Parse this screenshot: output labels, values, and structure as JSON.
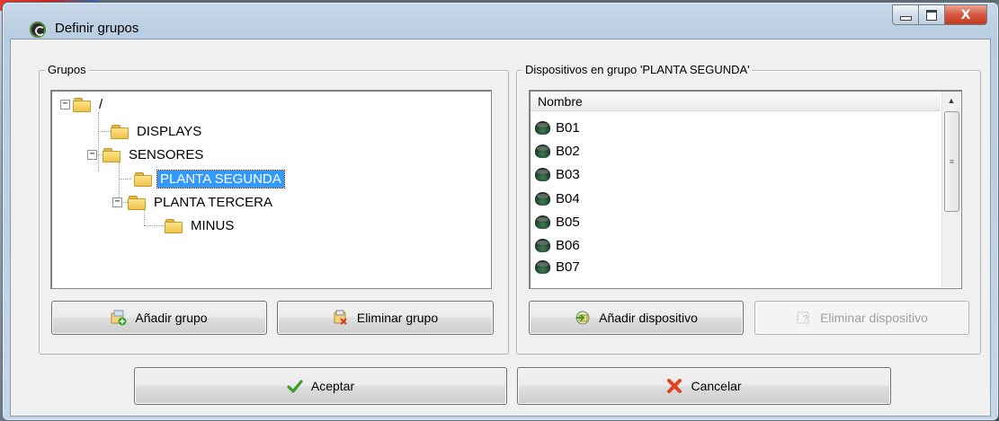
{
  "window": {
    "title": "Definir grupos",
    "controls": {
      "minimize_icon": "minimize-icon",
      "maximize_icon": "maximize-icon",
      "close_label": "X"
    }
  },
  "groups_panel": {
    "legend": "Grupos",
    "tree": [
      {
        "label": "/",
        "level": 0,
        "expander": "−"
      },
      {
        "label": "DISPLAYS",
        "level": 1,
        "expander": ""
      },
      {
        "label": "SENSORES",
        "level": 1,
        "expander": "−"
      },
      {
        "label": "PLANTA SEGUNDA",
        "level": 2,
        "expander": "",
        "selected": true
      },
      {
        "label": "PLANTA TERCERA",
        "level": 2,
        "expander": "−"
      },
      {
        "label": "MINUS",
        "level": 3,
        "expander": ""
      }
    ],
    "add_button": "Añadir grupo",
    "delete_button": "Eliminar grupo"
  },
  "devices_panel": {
    "legend": "Dispositivos en grupo 'PLANTA SEGUNDA'",
    "column_header": "Nombre",
    "devices": [
      "B01",
      "B02",
      "B03",
      "B04",
      "B05",
      "B06",
      "B07"
    ],
    "add_button": "Añadir dispositivo",
    "delete_button": "Eliminar dispositivo",
    "delete_disabled": true,
    "scroll_up": "▲",
    "scroll_grip": "≡"
  },
  "footer": {
    "accept_button": "Aceptar",
    "cancel_button": "Cancelar"
  },
  "colors": {
    "selection": "#3399ff",
    "accept_check": "#3f9d2a",
    "cancel_x": "#e0441e"
  }
}
